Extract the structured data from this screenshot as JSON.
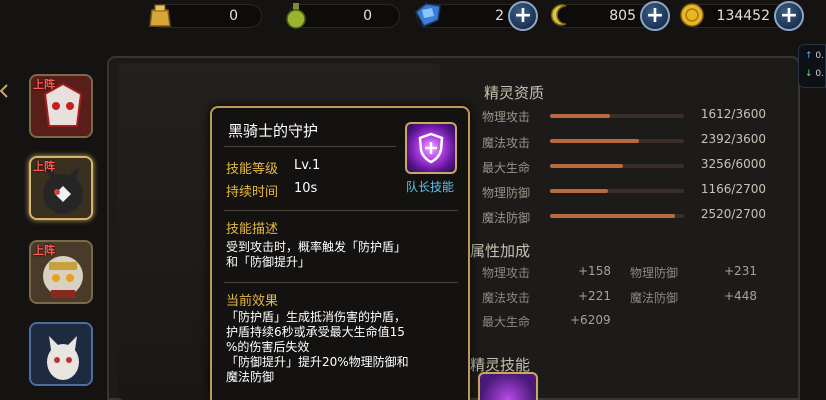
{
  "currencies": [
    {
      "name": "stamina",
      "icon": "gold-bag-icon",
      "value": "0"
    },
    {
      "name": "potion",
      "icon": "potion-flask-icon",
      "value": "0"
    },
    {
      "name": "gems",
      "icon": "blue-gem-icon",
      "value": "2"
    },
    {
      "name": "crescent",
      "icon": "crescent-coin-icon",
      "value": "805"
    },
    {
      "name": "gold",
      "icon": "gold-coin-icon",
      "value": "134452"
    }
  ],
  "plus_symbol": "+",
  "avatars": [
    {
      "tag": "上阵",
      "name": "masked-hero"
    },
    {
      "tag": "上阵",
      "name": "dark-knight-cat"
    },
    {
      "tag": "上阵",
      "name": "golden-beast"
    },
    {
      "tag": "",
      "name": "white-cat"
    }
  ],
  "qualities": {
    "title": "精灵资质",
    "rows": [
      {
        "label": "物理攻击",
        "value": "1612/3600",
        "fraction": 0.448
      },
      {
        "label": "魔法攻击",
        "value": "2392/3600",
        "fraction": 0.664
      },
      {
        "label": "最大生命",
        "value": "3256/6000",
        "fraction": 0.543
      },
      {
        "label": "物理防御",
        "value": "1166/2700",
        "fraction": 0.432
      },
      {
        "label": "魔法防御",
        "value": "2520/2700",
        "fraction": 0.933
      }
    ]
  },
  "attributes": {
    "title": "属性加成",
    "rows": [
      {
        "l1": "物理攻击",
        "v1": "+158",
        "l2": "物理防御",
        "v2": "+231"
      },
      {
        "l1": "魔法攻击",
        "v1": "+221",
        "l2": "魔法防御",
        "v2": "+448"
      },
      {
        "l1": "最大生命",
        "v1": "+6209",
        "l2": "",
        "v2": ""
      }
    ]
  },
  "spirit_skill_title": "精灵技能",
  "tooltip": {
    "title": "黑骑士的守护",
    "level_key": "技能等级",
    "level_value": "Lv.1",
    "duration_key": "持续时间",
    "duration_value": "10s",
    "skill_tag": "队长技能",
    "desc_head": "技能描述",
    "desc_body": "受到攻击时，概率触发「防护盾」\n和「防御提升」",
    "effect_head": "当前效果",
    "effect_body": "「防护盾」生成抵消伤害的护盾，\n护盾持续6秒或承受最大生命值15\n%的伤害后失效\n「防御提升」提升20%物理防御和\n魔法防御"
  },
  "edge_widget": {
    "up": "0.",
    "down": "0."
  },
  "colors": {
    "accent_gold": "#e6b93f",
    "bar_fill": "#b86a3c",
    "skill_tag": "#5fc3f0",
    "tag_red": "#ff5a55"
  }
}
